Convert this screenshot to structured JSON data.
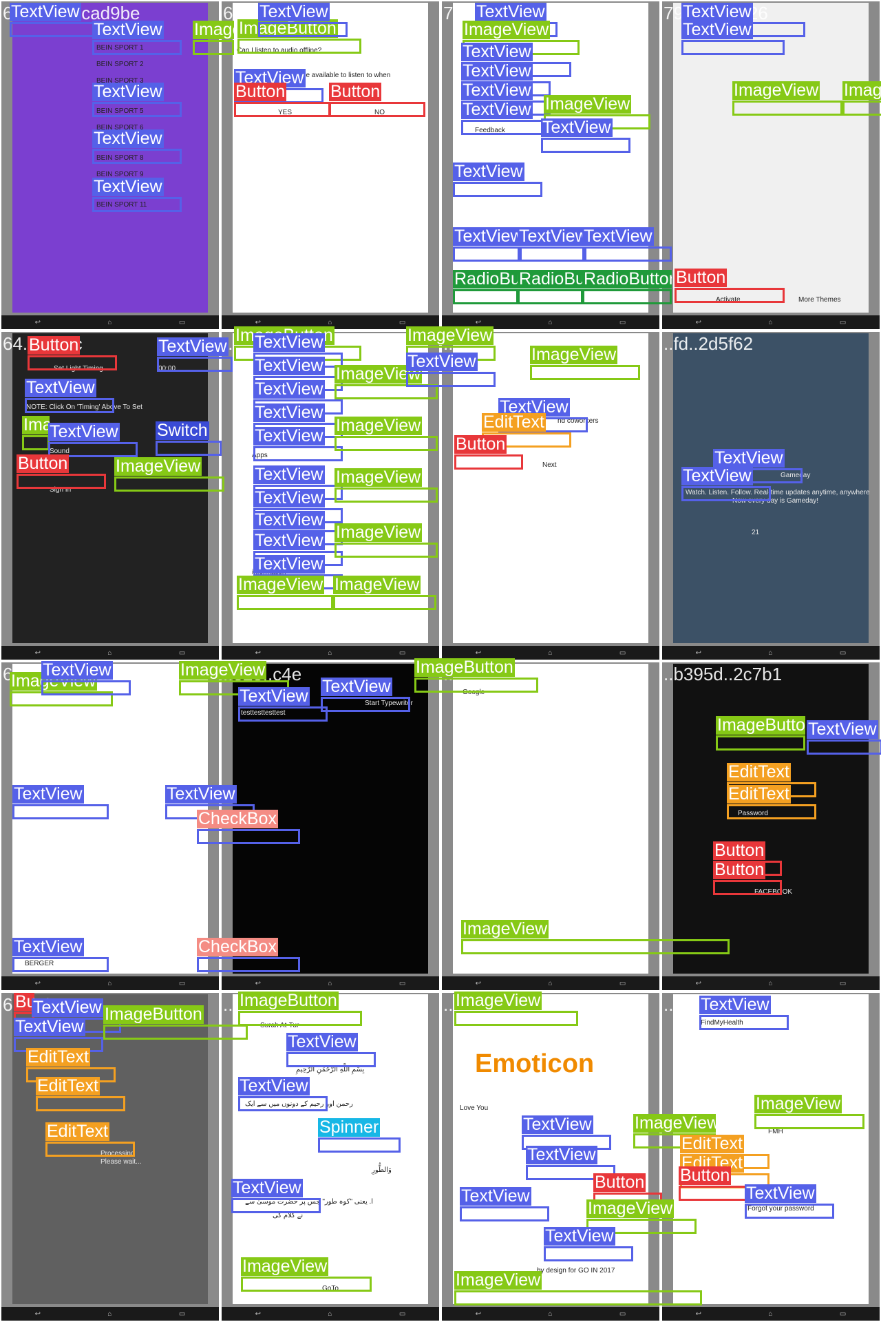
{
  "tags": {
    "textview": "TextView",
    "imageview": "ImageView",
    "imagebutton": "ImageButton",
    "button": "Button",
    "edittext": "EditText",
    "switch": "Switch",
    "spinner": "Spinner",
    "checkbox": "CheckBox",
    "radiobutton": "RadioButton"
  },
  "tiles": [
    {
      "id": "64c1..d05cad9be",
      "items": [
        "BEIN SPORT 1",
        "BEIN SPORT 2",
        "BEIN SPORT 3",
        "BEIN SPORT 5",
        "BEIN SPORT 6",
        "BEIN SPORT 8",
        "BEIN SPORT 9",
        "BEIN SPORT 11"
      ]
    },
    {
      "id": "64c..7c9176",
      "question": "Can I listen to audio offline?",
      "body": "track it will be available to listen to when",
      "yes": "YES",
      "no": "NO"
    },
    {
      "id": "76..34725e4b0",
      "feedback": "Feedback"
    },
    {
      "id": "79..6618af26",
      "activate": "Activate",
      "more": "More Themes"
    },
    {
      "id": "64..rf.3f0c",
      "title": "Set Light Timing",
      "time": "00:00",
      "note": "NOTE: Click On 'Timing' Above To Set",
      "sound": "Sound",
      "signin": "Sign In"
    },
    {
      "id": "..c5c",
      "apps": "Apps",
      "information": "information"
    },
    {
      "id": "..d7..21890",
      "coworkers": "nd coworkers",
      "next": "Next"
    },
    {
      "id": "..fd..2d5f62",
      "headline": "Gameday",
      "tagline": "Watch. Listen. Follow. Real-time updates anytime, anywhere",
      "sub": "Now every day is Gameday!",
      "jersey": "21"
    },
    {
      "id": "6..",
      "search": "BERGER"
    },
    {
      "id": "..e25..c4e",
      "test": "testtesttesttest",
      "typewriter": "Start Typewriter"
    },
    {
      "id": "..b0e3..6fd6",
      "search": "Google"
    },
    {
      "id": "..b395d..2c7b1",
      "facebook": "FACEBOOK",
      "password": "Password"
    },
    {
      "id": "6..3..34",
      "processing": "Processing",
      "wait": "Please wait..."
    },
    {
      "id": "..",
      "surah": "Surah At-Tur",
      "bismillah": "بِسْمِ اللَّهِ الرَّحْمَنِ الرَّحِيمِ",
      "verse": "وَالطُّورِ",
      "goto": "GoTo",
      "urdu1": "رحمن اور رحیم کے دونوں میں سے ایک",
      "urdu2": "ا. یعنی \"کوہ طور\" جس پر حضرت موسیٰ سے",
      "urdu3": "نے کلام کی"
    },
    {
      "id": "..7c5b..",
      "emoticon": "Emoticon",
      "love": "Love You",
      "designed": "by design for GO IN 2017"
    },
    {
      "id": "..2a9e..",
      "app": "FindMyHealth",
      "badge": "FMH",
      "forgot": "Forgot your password"
    }
  ]
}
